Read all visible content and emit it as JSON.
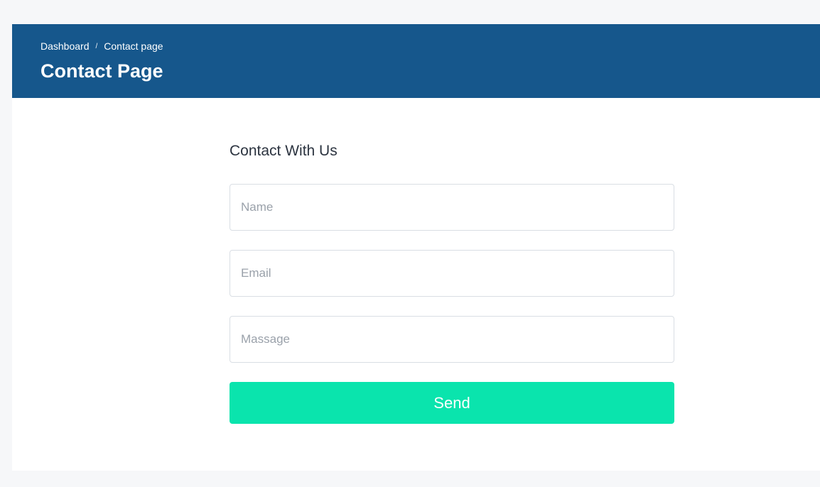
{
  "header": {
    "breadcrumb": {
      "items": [
        "Dashboard",
        "Contact page"
      ],
      "separator": "/"
    },
    "title": "Contact Page"
  },
  "form": {
    "heading": "Contact With Us",
    "fields": {
      "name": {
        "value": "",
        "placeholder": "Name"
      },
      "email": {
        "value": "",
        "placeholder": "Email"
      },
      "message": {
        "value": "",
        "placeholder": "Massage"
      }
    },
    "submit_label": "Send"
  },
  "colors": {
    "header_bg": "#16578c",
    "accent": "#0ae4ad",
    "page_bg": "#f6f7f9"
  }
}
